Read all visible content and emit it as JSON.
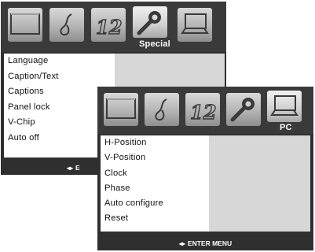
{
  "back_menu": {
    "tab_title": "Special",
    "tabs": [
      {
        "name": "screen-icon"
      },
      {
        "name": "music-note-icon"
      },
      {
        "name": "clock-number-icon"
      },
      {
        "name": "wrench-icon"
      },
      {
        "name": "laptop-icon"
      }
    ],
    "items": [
      "Language",
      "Caption/Text",
      "Captions",
      "Panel lock",
      "V-Chip",
      "Auto off"
    ],
    "footer": {
      "arrows": "◂▸",
      "label": "E"
    }
  },
  "front_menu": {
    "tab_title": "PC",
    "tabs": [
      {
        "name": "screen-icon"
      },
      {
        "name": "music-note-icon"
      },
      {
        "name": "clock-number-icon"
      },
      {
        "name": "wrench-icon"
      },
      {
        "name": "laptop-icon"
      }
    ],
    "items": [
      "H-Position",
      "V-Position",
      "Clock",
      "Phase",
      "Auto configure",
      "Reset"
    ],
    "footer": {
      "arrows": "◂▸",
      "label": "ENTER MENU"
    }
  },
  "colors": {
    "menu_bg": "#2f2f2f",
    "panel_grey": "#d7d7d7",
    "item_text": "#111111",
    "footer_text": "#ffffff"
  }
}
